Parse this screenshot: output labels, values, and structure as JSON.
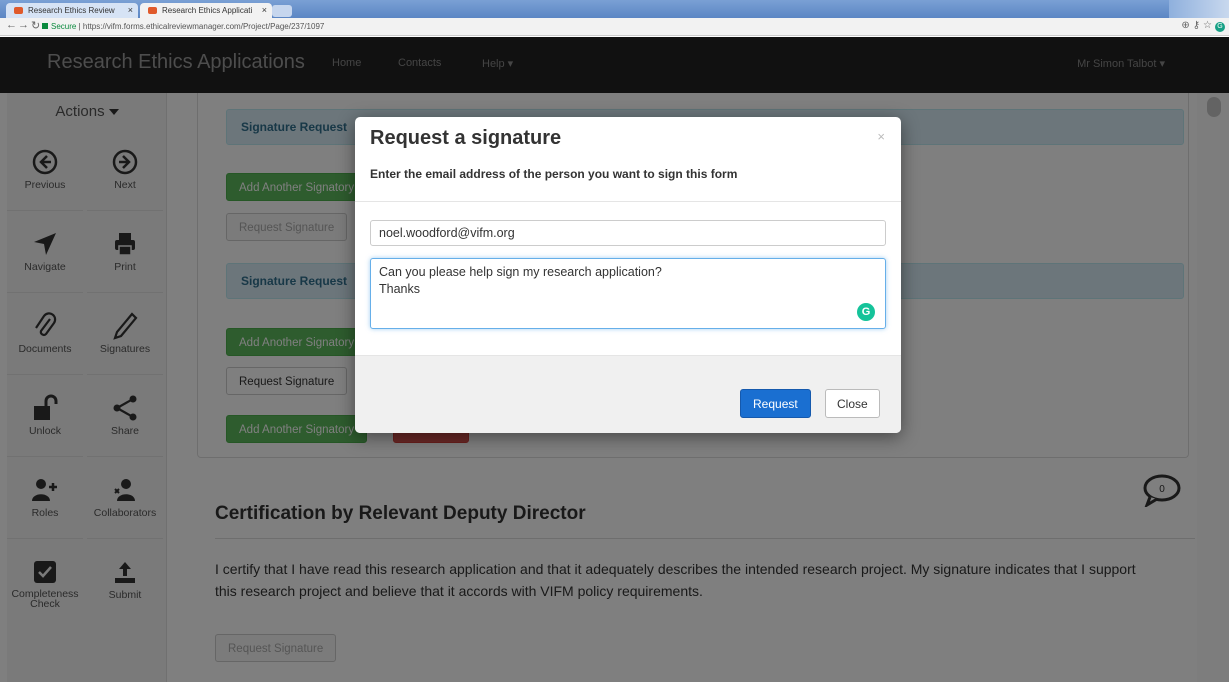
{
  "browser": {
    "tabs": [
      {
        "label": "Research Ethics Review"
      },
      {
        "label": "Research Ethics Applicati"
      }
    ],
    "secure_label": "Secure",
    "url": "https://vifm.forms.ethicalreviewmanager.com/Project/Page/237/1097"
  },
  "navbar": {
    "brand": "Research Ethics Applications",
    "links": [
      "Home",
      "Contacts",
      "Help ▾"
    ],
    "user": "Mr Simon Talbot ▾"
  },
  "sidebar": {
    "header": "Actions",
    "items": [
      {
        "label": "Previous",
        "icon": "arrow-left-circle-icon"
      },
      {
        "label": "Next",
        "icon": "arrow-right-circle-icon"
      },
      {
        "label": "Navigate",
        "icon": "navigate-icon"
      },
      {
        "label": "Print",
        "icon": "printer-icon"
      },
      {
        "label": "Documents",
        "icon": "paperclip-icon"
      },
      {
        "label": "Signatures",
        "icon": "pencil-icon"
      },
      {
        "label": "Unlock",
        "icon": "unlock-icon"
      },
      {
        "label": "Share",
        "icon": "share-icon"
      },
      {
        "label": "Roles",
        "icon": "add-user-icon"
      },
      {
        "label": "Collaborators",
        "icon": "collaborators-icon"
      },
      {
        "label": "Completeness Check",
        "icon": "checkbox-icon"
      },
      {
        "label": "Submit",
        "icon": "upload-icon"
      }
    ]
  },
  "main": {
    "sig_heading_1": "Signature Request",
    "sig_heading_2": "Signature Request",
    "add_signatory_1": "Add Another Signatory",
    "request_sig_1": "Request Signature",
    "add_signatory_2": "Add Another Signatory",
    "request_sig_2": "Request Signature",
    "add_signatory_3": "Add Another Signatory",
    "cert_title": "Certification by Relevant Deputy Director",
    "comment_count": "0",
    "cert_text": "I certify that I have read this research application and that it adequately describes the intended research project. My signature indicates that I support this research project and believe that it accords with VIFM policy requirements.",
    "cert_request": "Request Signature"
  },
  "modal": {
    "title": "Request a signature",
    "subtitle": "Enter the email address of the person you want to sign this form",
    "close_glyph": "×",
    "email_value": "noel.woodford@vifm.org",
    "message_value": "Can you please help sign my research application?\nThanks",
    "request_label": "Request",
    "close_label": "Close"
  }
}
